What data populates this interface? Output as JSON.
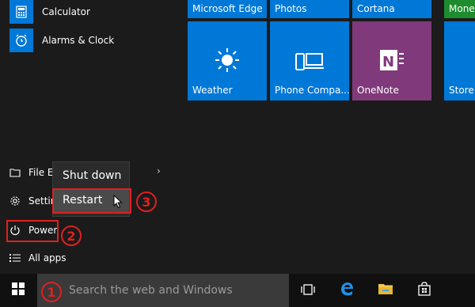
{
  "start_menu": {
    "apps": [
      {
        "label": "Calculator",
        "icon": "calculator-icon"
      },
      {
        "label": "Alarms & Clock",
        "icon": "alarm-clock-icon"
      }
    ],
    "places": [
      {
        "label": "File Ex",
        "icon": "file-explorer-icon"
      },
      {
        "label": "Settin",
        "icon": "settings-gear-icon"
      },
      {
        "label": "Power",
        "icon": "power-icon"
      },
      {
        "label": "All apps",
        "icon": "list-icon"
      }
    ]
  },
  "power_menu": {
    "items": [
      "Shut down",
      "Restart"
    ]
  },
  "tiles": {
    "top_row": [
      "Microsoft Edge",
      "Photos",
      "Cortana",
      "Mone"
    ],
    "second_row": [
      "Weather",
      "Phone Compa...",
      "OneNote",
      "Store"
    ]
  },
  "taskbar": {
    "search_placeholder": "Search the web and Windows",
    "icons": [
      "start-icon",
      "task-view-icon",
      "edge-icon",
      "file-explorer-icon",
      "store-icon"
    ]
  },
  "annotations": {
    "step1": "1",
    "step2": "2",
    "step3": "3"
  },
  "colors": {
    "accent": "#0078d7",
    "onenote": "#80397b",
    "money": "#1e8c2e",
    "annotation": "#e02020"
  }
}
